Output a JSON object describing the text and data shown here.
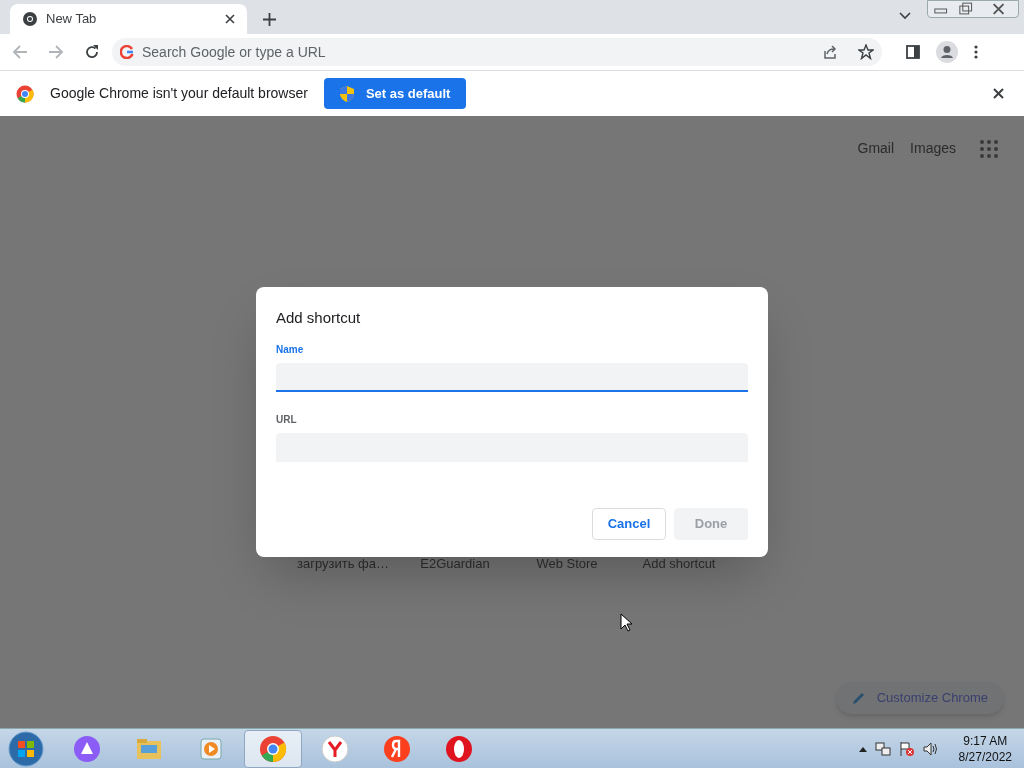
{
  "tab": {
    "title": "New Tab",
    "selected": true
  },
  "omnibox": {
    "placeholder": "Search Google or type a URL"
  },
  "infobar": {
    "message": "Google Chrome isn't your default browser",
    "button": "Set as default"
  },
  "ntp": {
    "links": [
      "Gmail",
      "Images"
    ],
    "shortcuts": [
      "загрузить фа…",
      "E2Guardian",
      "Web Store",
      "Add shortcut"
    ],
    "customize": "Customize Chrome"
  },
  "dialog": {
    "title": "Add shortcut",
    "fields": [
      {
        "label": "Name",
        "focused": true
      },
      {
        "label": "URL",
        "focused": false
      }
    ],
    "buttons": [
      {
        "label": "Cancel",
        "disabled": false
      },
      {
        "label": "Done",
        "disabled": true
      }
    ]
  },
  "taskbar": {
    "apps": [
      {
        "kind": "alice",
        "selected": false
      },
      {
        "kind": "folder",
        "selected": false
      },
      {
        "kind": "media",
        "selected": false
      },
      {
        "kind": "chrome",
        "selected": true
      },
      {
        "kind": "yandex-browser",
        "selected": false
      },
      {
        "kind": "yandex",
        "selected": false
      },
      {
        "kind": "opera",
        "selected": false
      }
    ],
    "time": "9:17 AM",
    "date": "8/27/2022"
  }
}
